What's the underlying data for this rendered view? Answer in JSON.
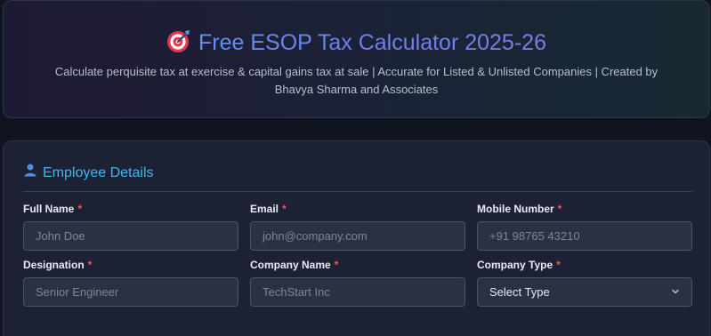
{
  "header": {
    "title_icon": "target-dart-icon",
    "title": "Free ESOP Tax Calculator 2025-26",
    "subtitle": "Calculate perquisite tax at exercise & capital gains tax at sale | Accurate for Listed & Unlisted Companies | Created by Bhavya Sharma and Associates"
  },
  "section": {
    "icon": "user-icon",
    "title": "Employee Details"
  },
  "fields": {
    "full_name": {
      "label": "Full Name",
      "required": "*",
      "placeholder": "John Doe",
      "value": ""
    },
    "email": {
      "label": "Email",
      "required": "*",
      "placeholder": "john@company.com",
      "value": ""
    },
    "mobile": {
      "label": "Mobile Number",
      "required": "*",
      "placeholder": "+91 98765 43210",
      "value": ""
    },
    "designation": {
      "label": "Designation",
      "required": "*",
      "placeholder": "Senior Engineer",
      "value": ""
    },
    "company_name": {
      "label": "Company Name",
      "required": "*",
      "placeholder": "TechStart Inc",
      "value": ""
    },
    "company_type": {
      "label": "Company Type",
      "required": "*",
      "selected": "Select Type"
    }
  },
  "colors": {
    "accent": "#42b6ee",
    "required": "#ef5b5b",
    "title_gradient_start": "#5ea3f5",
    "title_gradient_end": "#8d79ea"
  }
}
